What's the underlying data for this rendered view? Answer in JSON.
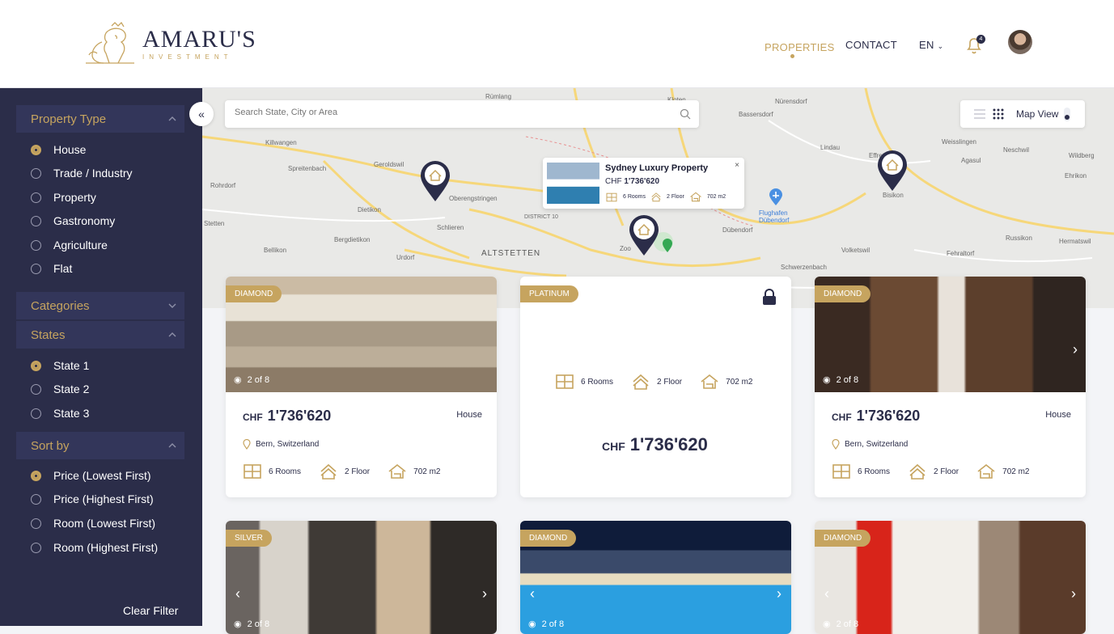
{
  "brand": {
    "name": "AMARU'S",
    "sub": "INVESTMENT"
  },
  "nav": {
    "properties": "PROPERTIES",
    "contact": "CONTACT",
    "lang": "EN",
    "notifications": "4"
  },
  "sidebar": {
    "property_type": {
      "title": "Property Type",
      "options": [
        "House",
        "Trade / Industry",
        "Property",
        "Gastronomy",
        "Agriculture",
        "Flat"
      ],
      "selected": "House"
    },
    "categories": {
      "title": "Categories"
    },
    "states": {
      "title": "States",
      "options": [
        "State 1",
        "State 2",
        "State 3"
      ],
      "selected": "State 1"
    },
    "sort_by": {
      "title": "Sort by",
      "options": [
        "Price (Lowest First)",
        "Price (Highest First)",
        "Room (Lowest First)",
        "Room (Highest First)"
      ],
      "selected": "Price (Lowest First)"
    },
    "clear": "Clear Filter"
  },
  "search": {
    "placeholder": "Search State, City or Area"
  },
  "map": {
    "view_label": "Map View",
    "labels": [
      "Rümlang",
      "Kloten",
      "Nürensdorf",
      "Bassersdorf",
      "Killwangen",
      "Spreitenbach",
      "Geroldswil",
      "Oberengstringen",
      "Dietikon",
      "Schlieren",
      "Urdorf",
      "Bergdietikon",
      "Bellikon",
      "Rohrdorf",
      "Stetten",
      "DISTRICT 10",
      "ALTSTETTEN",
      "Dübendorf",
      "Flughafen Dübendorf",
      "Lindau",
      "Effretikon",
      "Weisslingen",
      "Neschwil",
      "Wildberg",
      "Agasul",
      "Ehrikon",
      "Bisikon",
      "Russikon",
      "Hermatswil",
      "Fehraltorf",
      "Volketswil",
      "Schwerzenbach",
      "Zoo"
    ],
    "popup": {
      "title": "Sydney Luxury Property",
      "currency": "CHF",
      "price": "1'736'620",
      "rooms": "6 Rooms",
      "floor": "2 Floor",
      "area": "702 m2",
      "close": "×"
    }
  },
  "cards": [
    {
      "badge": "DIAMOND",
      "photos": "2 of 8",
      "currency": "CHF",
      "price": "1'736'620",
      "type": "House",
      "location": "Bern, Switzerland",
      "rooms": "6 Rooms",
      "floor": "2 Floor",
      "area": "702 m2"
    },
    {
      "badge": "PLATINUM",
      "currency": "CHF",
      "price": "1'736'620",
      "rooms": "6 Rooms",
      "floor": "2 Floor",
      "area": "702 m2",
      "locked": true
    },
    {
      "badge": "DIAMOND",
      "photos": "2 of 8",
      "currency": "CHF",
      "price": "1'736'620",
      "type": "House",
      "location": "Bern, Switzerland",
      "rooms": "6 Rooms",
      "floor": "2 Floor",
      "area": "702 m2"
    },
    {
      "badge": "SILVER",
      "photos": "2 of 8"
    },
    {
      "badge": "DIAMOND",
      "photos": "2 of 8"
    },
    {
      "badge": "DIAMOND",
      "photos": "2 of 8"
    }
  ],
  "colors": {
    "navy": "#2b2d49",
    "gold": "#c6a45f"
  }
}
